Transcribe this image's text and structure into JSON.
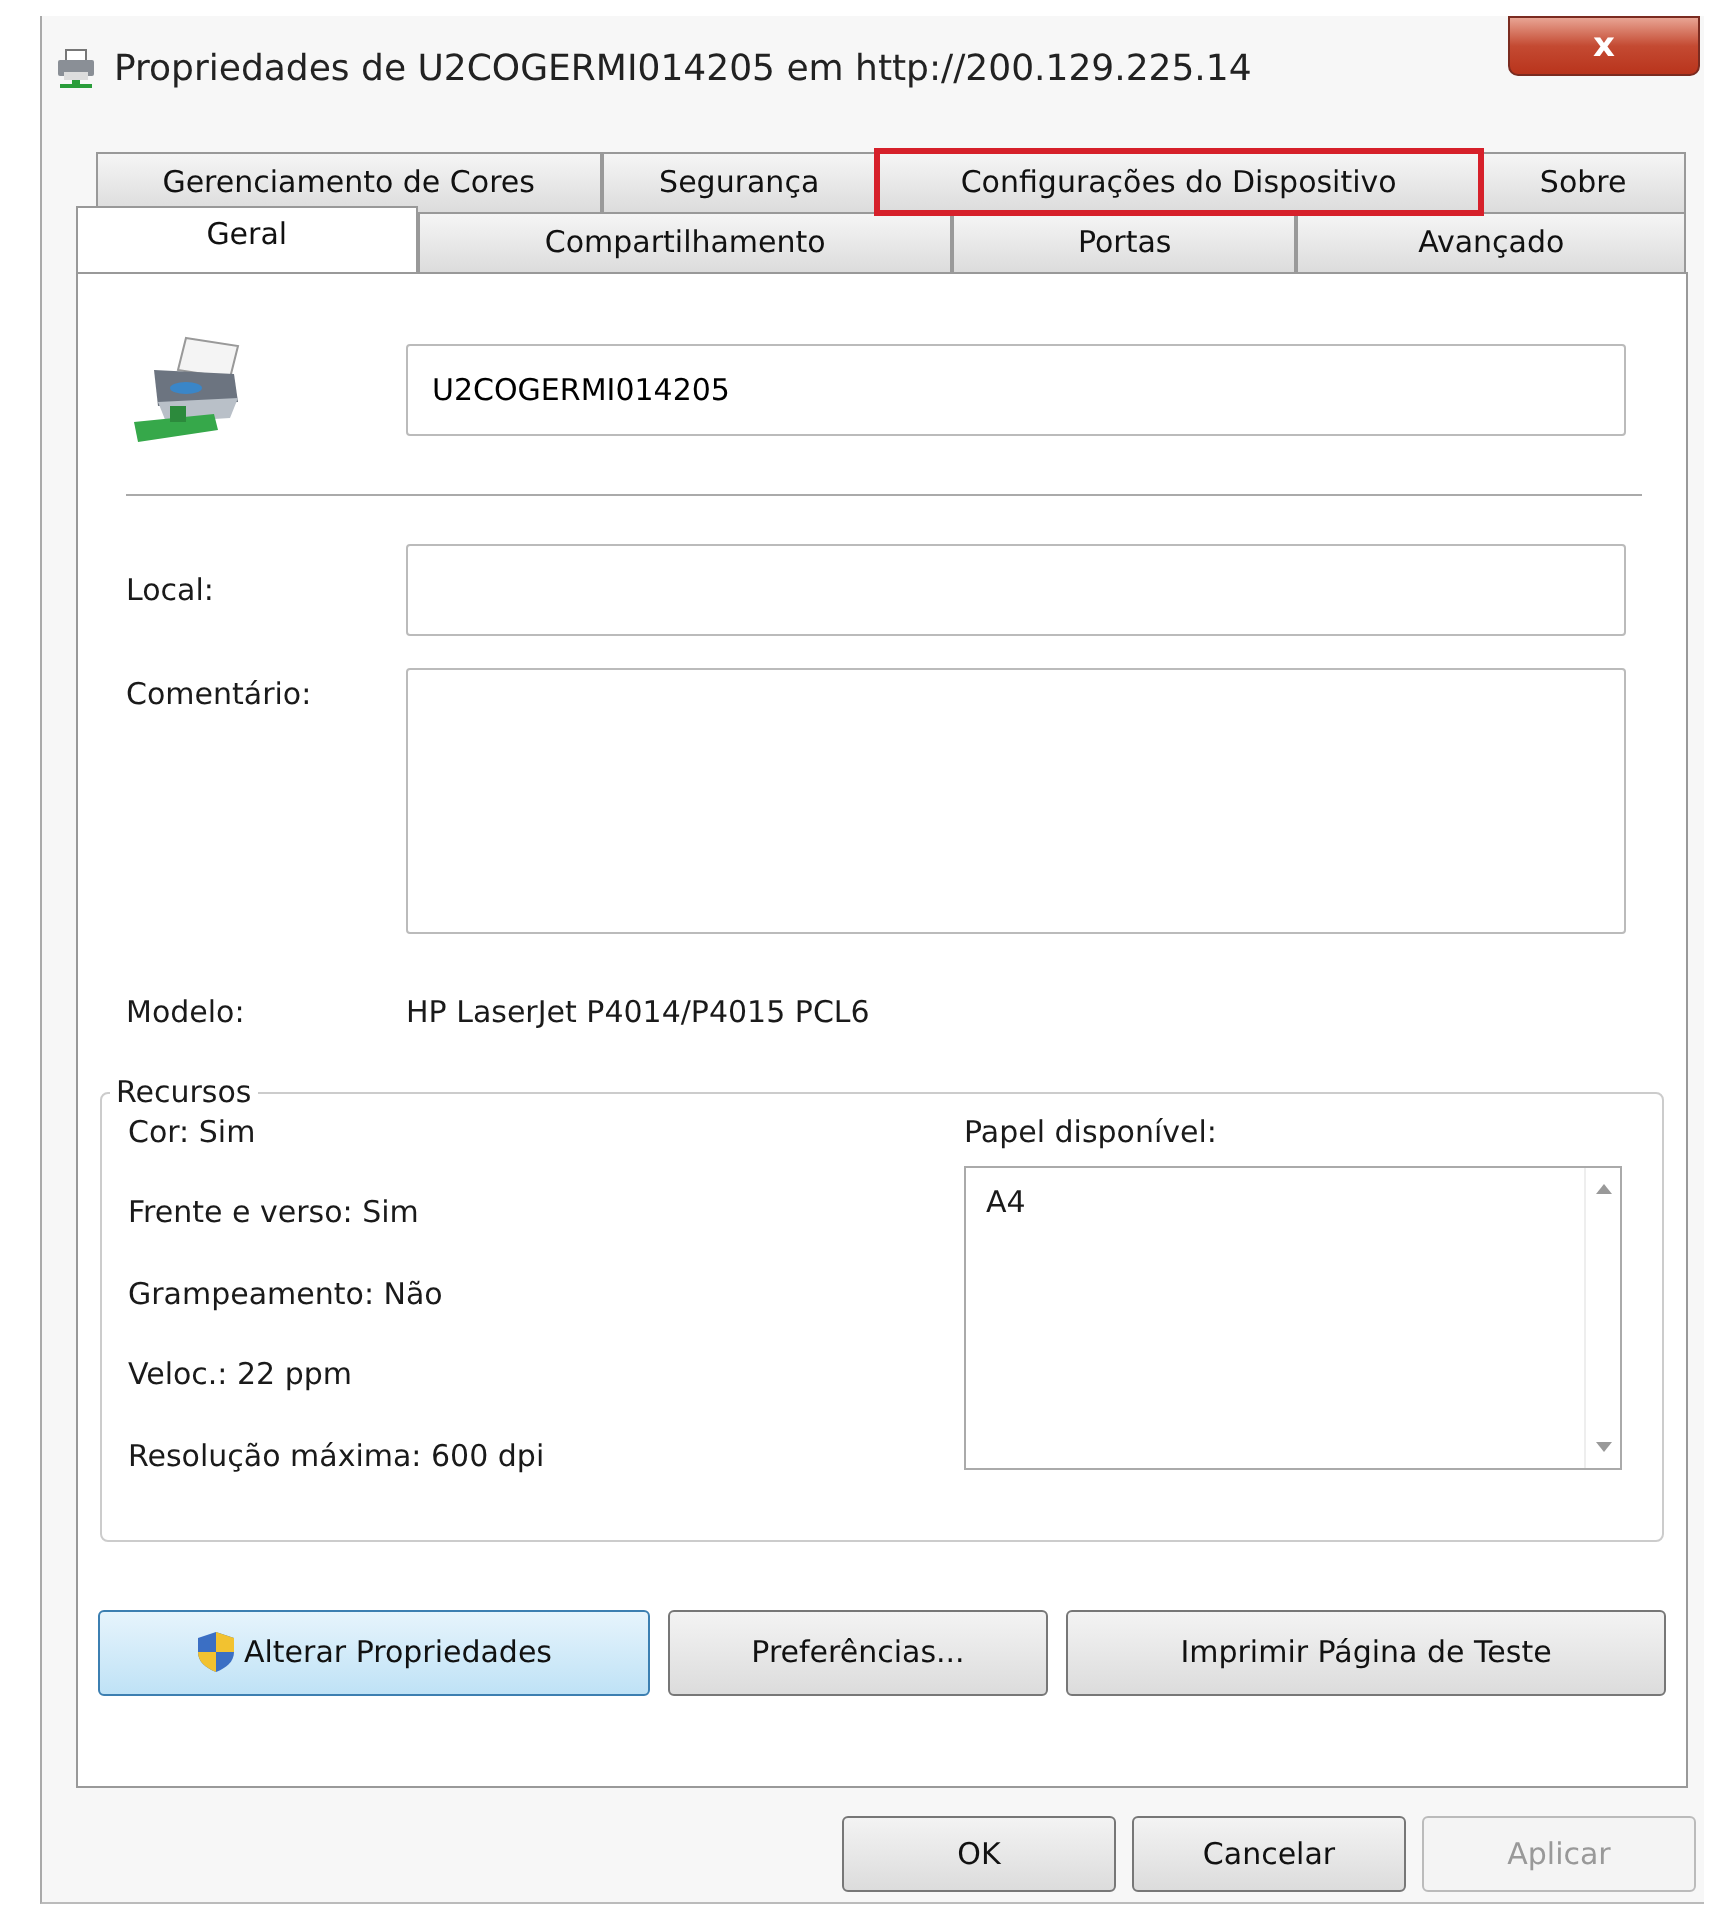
{
  "window": {
    "title": "Propriedades de U2COGERMI014205 em http://200.129.225.14",
    "close": "x"
  },
  "tab_rows": [
    {
      "tabs": [
        {
          "label": "Gerenciamento de Cores",
          "selected": false,
          "highlighted": false
        },
        {
          "label": "Segurança",
          "selected": false,
          "highlighted": false
        },
        {
          "label": "Configurações do Dispositivo",
          "selected": false,
          "highlighted": true
        },
        {
          "label": "Sobre",
          "selected": false,
          "highlighted": false
        }
      ]
    },
    {
      "tabs": [
        {
          "label": "Geral",
          "selected": true,
          "highlighted": false
        },
        {
          "label": "Compartilhamento",
          "selected": false,
          "highlighted": false
        },
        {
          "label": "Portas",
          "selected": false,
          "highlighted": false
        },
        {
          "label": "Avançado",
          "selected": false,
          "highlighted": false
        }
      ]
    }
  ],
  "printer_name": {
    "value": "U2COGERMI014205"
  },
  "fields": [
    {
      "label": "Local:",
      "kind": "input"
    },
    {
      "label": "Comentário:",
      "kind": "textarea"
    }
  ],
  "model": {
    "label": "Modelo:",
    "value": "HP LaserJet P4014/P4015 PCL6"
  },
  "resources": {
    "title": "Recursos",
    "features": [
      "Cor: Sim",
      "Frente e verso: Sim",
      "Grampeamento: Não",
      "Veloc.: 22 ppm",
      "Resolução máxima: 600 dpi"
    ],
    "paper_label": "Papel disponível:",
    "paper": [
      "A4"
    ]
  },
  "actions": [
    {
      "label": "Alterar Propriedades",
      "shield": true,
      "focused": true
    },
    {
      "label": "Preferências...",
      "shield": false,
      "focused": false
    },
    {
      "label": "Imprimir Página de Teste",
      "shield": false,
      "focused": false
    }
  ],
  "buttons": [
    {
      "label": "OK",
      "disabled": false
    },
    {
      "label": "Cancelar",
      "disabled": false
    },
    {
      "label": "Aplicar",
      "disabled": true
    }
  ]
}
